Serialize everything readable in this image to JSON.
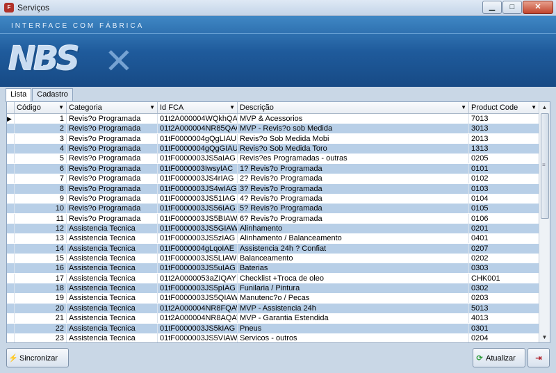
{
  "window": {
    "title": "Serviços",
    "app_icon": "fiat-icon"
  },
  "banner": {
    "subtitle": "INTERFACE COM FÁBRICA",
    "logo_text": "NBS"
  },
  "tabs": [
    {
      "label": "Lista"
    },
    {
      "label": "Cadastro"
    }
  ],
  "grid": {
    "columns": [
      {
        "label": "Código"
      },
      {
        "label": "Categoria"
      },
      {
        "label": "Id FCA"
      },
      {
        "label": "Descrição"
      },
      {
        "label": "Product Code"
      }
    ],
    "rows": [
      {
        "codigo": "1",
        "categoria": "Revis?o Programada",
        "id": "01t2A000004WQkhQAG",
        "descricao": "MVP & Acessorios",
        "product": "7013"
      },
      {
        "codigo": "2",
        "categoria": "Revis?o Programada",
        "id": "01t2A000004NR85QAG",
        "descricao": "MVP - Revis?o sob Medida",
        "product": "3013"
      },
      {
        "codigo": "3",
        "categoria": "Revis?o Programada",
        "id": "01tF0000004gQgLIAU",
        "descricao": "Revis?o Sob Medida Mobi",
        "product": "2013"
      },
      {
        "codigo": "4",
        "categoria": "Revis?o Programada",
        "id": "01tF0000004gQgGIAU",
        "descricao": "Revis?o Sob Medida Toro",
        "product": "1313"
      },
      {
        "codigo": "5",
        "categoria": "Revis?o Programada",
        "id": "01tF0000003JS5aIAG",
        "descricao": "Revis?es Programadas - outras",
        "product": "0205"
      },
      {
        "codigo": "6",
        "categoria": "Revis?o Programada",
        "id": "01tF0000003IwsyIAC",
        "descricao": "1? Revis?o Programada",
        "product": "0101"
      },
      {
        "codigo": "7",
        "categoria": "Revis?o Programada",
        "id": "01tF0000003JS4rIAG",
        "descricao": "2? Revis?o Programada",
        "product": "0102"
      },
      {
        "codigo": "8",
        "categoria": "Revis?o Programada",
        "id": "01tF0000003JS4wIAG",
        "descricao": "3? Revis?o Programada",
        "product": "0103"
      },
      {
        "codigo": "9",
        "categoria": "Revis?o Programada",
        "id": "01tF0000003JS51IAG",
        "descricao": "4? Revis?o Programada",
        "product": "0104"
      },
      {
        "codigo": "10",
        "categoria": "Revis?o Programada",
        "id": "01tF0000003JS56IAG",
        "descricao": "5? Revis?o Programada",
        "product": "0105"
      },
      {
        "codigo": "11",
        "categoria": "Revis?o Programada",
        "id": "01tF0000003JS5BIAW",
        "descricao": "6? Revis?o Programada",
        "product": "0106"
      },
      {
        "codigo": "12",
        "categoria": "Assistencia Tecnica",
        "id": "01tF0000003JS5GIAW",
        "descricao": "Alinhamento",
        "product": "0201"
      },
      {
        "codigo": "13",
        "categoria": "Assistencia Tecnica",
        "id": "01tF0000003JS5zIAG",
        "descricao": "Alinhamento / Balanceamento",
        "product": "0401"
      },
      {
        "codigo": "14",
        "categoria": "Assistencia Tecnica",
        "id": "01tF0000004gLqoIAE",
        "descricao": "Assistencia 24h ? Confiat",
        "product": "0207"
      },
      {
        "codigo": "15",
        "categoria": "Assistencia Tecnica",
        "id": "01tF0000003JS5LIAW",
        "descricao": "Balanceamento",
        "product": "0202"
      },
      {
        "codigo": "16",
        "categoria": "Assistencia Tecnica",
        "id": "01tF0000003JS5uIAG",
        "descricao": "Baterias",
        "product": "0303"
      },
      {
        "codigo": "17",
        "categoria": "Assistencia Tecnica",
        "id": "01t2A0000053aZIQAY",
        "descricao": "Checklist +Troca de oleo",
        "product": "CHK001"
      },
      {
        "codigo": "18",
        "categoria": "Assistencia Tecnica",
        "id": "01tF0000003JS5pIAG",
        "descricao": "Funilaria / Pintura",
        "product": "0302"
      },
      {
        "codigo": "19",
        "categoria": "Assistencia Tecnica",
        "id": "01tF0000003JS5QIAW",
        "descricao": "Manutenc?o / Pecas",
        "product": "0203"
      },
      {
        "codigo": "20",
        "categoria": "Assistencia Tecnica",
        "id": "01t2A000004NR8FQAW",
        "descricao": "MVP - Assistencia 24h",
        "product": "5013"
      },
      {
        "codigo": "21",
        "categoria": "Assistencia Tecnica",
        "id": "01t2A000004NR8AQAW",
        "descricao": "MVP - Garantia Estendida",
        "product": "4013"
      },
      {
        "codigo": "22",
        "categoria": "Assistencia Tecnica",
        "id": "01tF0000003JS5kIAG",
        "descricao": "Pneus",
        "product": "0301"
      },
      {
        "codigo": "23",
        "categoria": "Assistencia Tecnica",
        "id": "01tF0000003JS5VIAW",
        "descricao": "Servicos - outros",
        "product": "0204"
      }
    ]
  },
  "footer": {
    "sync_label": "Sincronizar",
    "refresh_label": "Atualizar"
  },
  "colors": {
    "banner": "#1f5b9c",
    "row_alt": "#b8cfe7"
  }
}
